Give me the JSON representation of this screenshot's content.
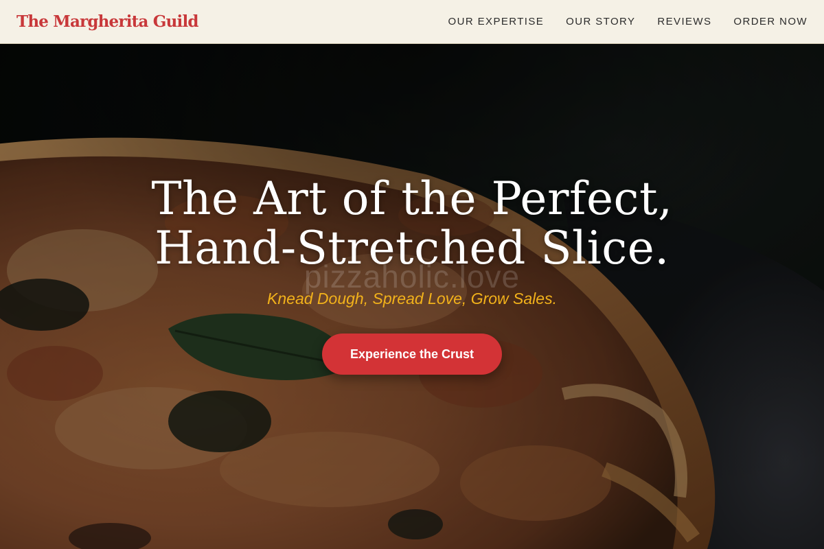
{
  "header": {
    "logo": "The Margherita Guild",
    "nav": [
      {
        "label": "OUR EXPERTISE"
      },
      {
        "label": "OUR STORY"
      },
      {
        "label": "REVIEWS"
      },
      {
        "label": "ORDER NOW"
      }
    ]
  },
  "hero": {
    "title_line1": "The Art of the Perfect,",
    "title_line2": "Hand-Stretched Slice.",
    "watermark": "pizzaholic.love",
    "tagline": "Knead Dough, Spread Love, Grow Sales.",
    "cta_label": "Experience the Crust",
    "background": "pizza-photo"
  },
  "colors": {
    "header_bg": "#f5f1e6",
    "brand": "#c8383a",
    "tagline": "#f2b21b",
    "cta_bg": "#d33336"
  }
}
